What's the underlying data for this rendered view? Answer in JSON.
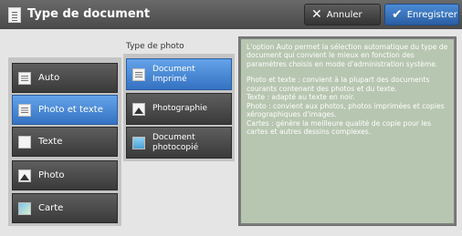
{
  "header": {
    "title": "Type de document",
    "cancel_label": "Annuler",
    "save_label": "Enregistrer",
    "cancel_icon": "x-icon",
    "save_icon": "checkmark-icon"
  },
  "document_types": [
    {
      "label": "Auto",
      "icon": "auto-document-icon",
      "selected": false
    },
    {
      "label": "Photo et texte",
      "icon": "photo-text-icon",
      "selected": true
    },
    {
      "label": "Texte",
      "icon": "text-document-icon",
      "selected": false
    },
    {
      "label": "Photo",
      "icon": "photo-icon",
      "selected": false
    },
    {
      "label": "Carte",
      "icon": "map-icon",
      "selected": false
    }
  ],
  "photo_type": {
    "label": "Type de photo",
    "options": [
      {
        "label": "Document\nImprimé",
        "icon": "printed-document-icon",
        "selected": true
      },
      {
        "label": "Photographie",
        "icon": "photograph-icon",
        "selected": false
      },
      {
        "label": "Document\nphotocopié",
        "icon": "photocopied-document-icon",
        "selected": false
      }
    ]
  },
  "info": {
    "paragraph1": "L'option Auto permet la sélection automatique du type de document qui convient le mieux en fonction des paramètres choisis en mode d'administration système.",
    "paragraph2": "Photo et texte : convient à la plupart des documents courants contenant des photos et du texte.\nTexte : adapté au texte en noir.\nPhoto : convient aux photos, photos imprimées et copies xérographiques d'images.\nCartes : génère la meilleure qualité de copie pour les cartes et autres dessins complexes."
  },
  "colors": {
    "selected": "#3e82d4",
    "button": "#4a4a4a",
    "info_background": "#b7c6b0"
  }
}
